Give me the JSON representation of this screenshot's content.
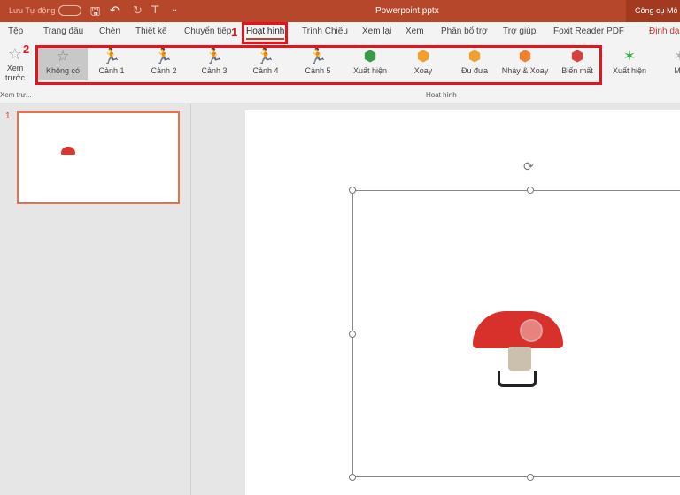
{
  "titlebar": {
    "autosave_label": "Lưu Tự động",
    "file_name": "Powerpoint.pptx",
    "context_tab": "Công cụ Mô h"
  },
  "tabs": [
    {
      "label": "Tệp"
    },
    {
      "label": "Trang đầu"
    },
    {
      "label": "Chèn"
    },
    {
      "label": "Thiết kế"
    },
    {
      "label": "Chuyển tiếp"
    },
    {
      "label": "Hoạt hình"
    },
    {
      "label": "Trình Chiếu"
    },
    {
      "label": "Xem lại"
    },
    {
      "label": "Xem"
    },
    {
      "label": "Phần bổ trợ"
    },
    {
      "label": "Trợ giúp"
    },
    {
      "label": "Foxit Reader PDF"
    },
    {
      "label": "Định dạ"
    }
  ],
  "ribbon": {
    "preview_label": "Xem trước",
    "preview_group": "Xem trư...",
    "group_label": "Hoạt hình",
    "gallery": [
      {
        "label": "Không có"
      },
      {
        "label": "Cảnh 1"
      },
      {
        "label": "Cảnh 2"
      },
      {
        "label": "Cảnh 3"
      },
      {
        "label": "Cảnh 4"
      },
      {
        "label": "Cảnh 5"
      },
      {
        "label": "Xuất hiện"
      },
      {
        "label": "Xoay"
      },
      {
        "label": "Đu đưa"
      },
      {
        "label": "Nhảy & Xoay"
      },
      {
        "label": "Biến mất"
      },
      {
        "label": "Xuất hiện"
      },
      {
        "label": "Mờ"
      }
    ]
  },
  "annotations": {
    "one": "1",
    "two": "2"
  },
  "slides": {
    "thumb_number": "1"
  },
  "colors": {
    "accent": "#b7472a",
    "annotation": "#e3141e"
  }
}
